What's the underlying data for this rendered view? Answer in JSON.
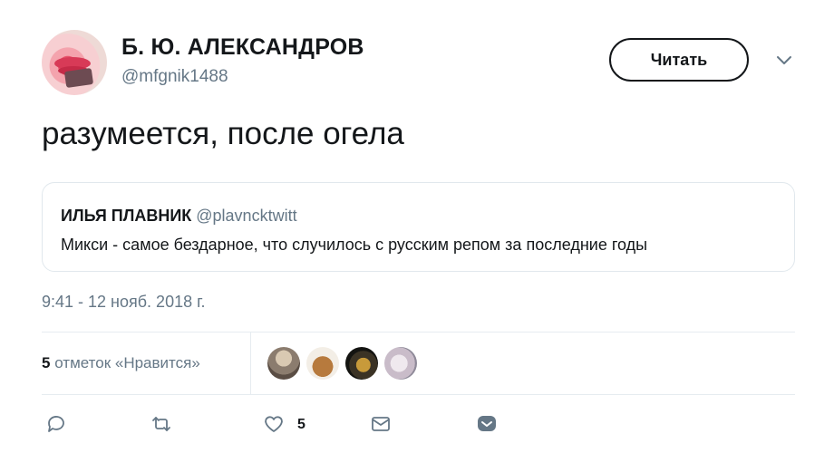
{
  "author": {
    "name": "Б. Ю. АЛЕКСАНДРОВ",
    "handle": "@mfgnik1488"
  },
  "follow_button": {
    "label": "Читать"
  },
  "tweet": {
    "text": "разумеется, после огела"
  },
  "quoted_tweet": {
    "author_name": "ИЛЬЯ ПЛАВНИК",
    "author_handle": "@plavncktwitt",
    "text": "Микси - самое бездарное, что случилось с русским репом за последние годы"
  },
  "timestamp": "9:41 - 12 нояб. 2018 г.",
  "likes": {
    "count": "5",
    "label": "отметок «Нравится»",
    "avatars": [
      "liker-avatar-1",
      "liker-avatar-2",
      "liker-avatar-3",
      "liker-avatar-4"
    ]
  },
  "actions": {
    "reply_icon": "reply-icon",
    "retweet_icon": "retweet-icon",
    "like_icon": "heart-icon",
    "like_count": "5",
    "dm_icon": "envelope-icon",
    "save_icon": "bookmark-icon"
  },
  "colors": {
    "text": "#14171a",
    "secondary": "#657786",
    "border": "#e1e8ed",
    "dm_active": "#657786"
  }
}
